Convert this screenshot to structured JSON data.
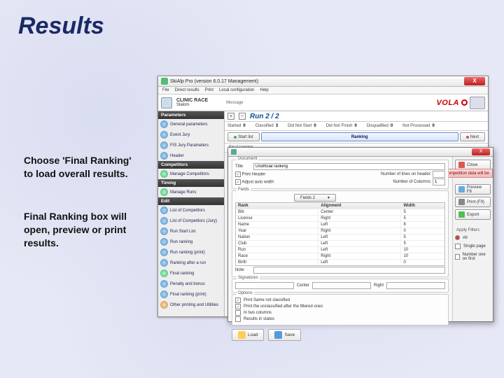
{
  "slide": {
    "title": "Results",
    "instruction1": "Choose 'Final Ranking' to load overall results.",
    "instruction2": "Final Ranking box will open, preview or print results."
  },
  "window": {
    "title": "SkiAlp Pro (version 6.0.17 Management)",
    "menus": [
      "File",
      "Direct results",
      "Print",
      "Local configuration",
      "Help"
    ],
    "event_label": "CLINIC RACE",
    "event_sub": "Slalom",
    "msg_label": "Message",
    "run_title": "Run 2 / 2",
    "brand": "VOLA",
    "counts": {
      "started_l": "Started",
      "started_v": "0",
      "classified_l": "Classified",
      "classified_v": "3",
      "dns_l": "Did Not Start",
      "dns_v": "0",
      "dnf_l": "Did Not Finish",
      "dnf_v": "0",
      "dsq_l": "Disqualified",
      "dsq_v": "0",
      "np_l": "Not Processed",
      "np_v": "0"
    },
    "buttons": {
      "startlist": "Start list",
      "ranking": "Ranking",
      "next": "Next"
    },
    "sidebar": {
      "parameters": "Parameters",
      "p_items": [
        "General parameters",
        "Event Jury",
        "FIS Jury Parameters",
        "Header"
      ],
      "competitors": "Competitors",
      "c_items": [
        "Manage Competitors"
      ],
      "timing": "Timing",
      "t_items": [
        "Manage Runs"
      ],
      "edit": "Edit",
      "e_items": [
        "List of Competitors",
        "List of Competitors (Jury)",
        "Run Start List",
        "Run ranking",
        "Run ranking (print)",
        "Ranking after a run",
        "Final ranking",
        "Penalty and bonus",
        "Final ranking (print)"
      ],
      "last": "Other printing and Utilities"
    },
    "subrow": {
      "final": "Final ranking"
    }
  },
  "dialog": {
    "doc_grp": "Document",
    "title_l": "Title",
    "title_v": "Unofficial ranking",
    "chk_header": "Print Header",
    "chk_adjust": "Adjust auto width",
    "lines_l": "Number of lines on header:",
    "cols_l": "Number of Columns:",
    "cols_v": "1",
    "fields_grp": "Fields",
    "fields_dd": "Fields 2",
    "fields": [
      {
        "f": "Rank",
        "a": "Alignment",
        "w": "Width"
      },
      {
        "f": "Bib",
        "a": "Center",
        "w": "5"
      },
      {
        "f": "License",
        "a": "Right",
        "w": "5"
      },
      {
        "f": "Name",
        "a": "Left",
        "w": "8"
      },
      {
        "f": "Year",
        "a": "Right",
        "w": "0"
      },
      {
        "f": "Nation",
        "a": "Left",
        "w": "5"
      },
      {
        "f": "Club",
        "a": "Left",
        "w": "5"
      },
      {
        "f": "Run",
        "a": "Left",
        "w": "10"
      },
      {
        "f": "Race",
        "a": "Right",
        "w": "10"
      },
      {
        "f": "Birth",
        "a": "Left",
        "w": "0"
      }
    ],
    "note_l": "Note",
    "sign_grp": "Signatures",
    "sign_c": "Center",
    "sign_r": "Right",
    "opt_grp": "Options",
    "opt1": "Print Same not classified",
    "opt2": "Print the unclassified after the filtered ones",
    "opt3": "In two columns",
    "opt4": "Results in states",
    "btn_load": "Load",
    "btn_save": "Save",
    "side": {
      "close": "Close",
      "red": "A competition data will be",
      "preview": "Preview F8",
      "print": "Print  (F9)",
      "export": "Export",
      "filters": "Apply Filters",
      "all": "All",
      "single": "Single page",
      "num": "Number one on first"
    }
  }
}
